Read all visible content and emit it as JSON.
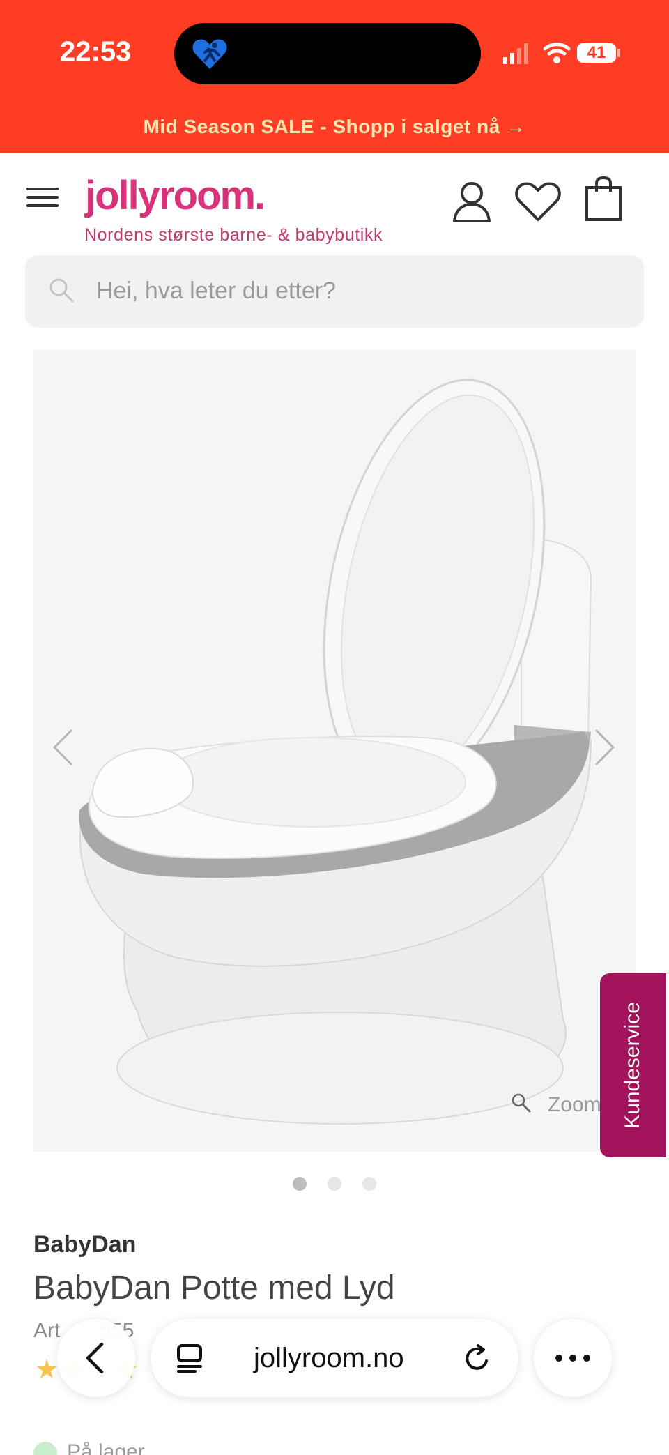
{
  "status_bar": {
    "time": "22:53",
    "battery": "41"
  },
  "promo_banner": {
    "text": "Mid Season SALE - Shopp i salget nå →"
  },
  "header": {
    "logo": "jollyroom.",
    "tagline": "Nordens største barne- & babybutikk"
  },
  "search": {
    "placeholder": "Hei, hva leter du etter?"
  },
  "gallery": {
    "zoom_label": "Zoom",
    "slide_count": 3,
    "active_slide": 1
  },
  "kundeservice": {
    "label": "Kundeservice"
  },
  "product": {
    "brand": "BabyDan",
    "title": "BabyDan Potte med Lyd",
    "article_partial": "Art",
    "article_number_partial": "555",
    "stock_partial": "På lager"
  },
  "browser": {
    "url": "jollyroom.no"
  },
  "colors": {
    "accent": "#ff3d24",
    "brand_pink": "#d6337a",
    "kundeservice_bg": "#a3135c",
    "star": "#f5c44a"
  }
}
